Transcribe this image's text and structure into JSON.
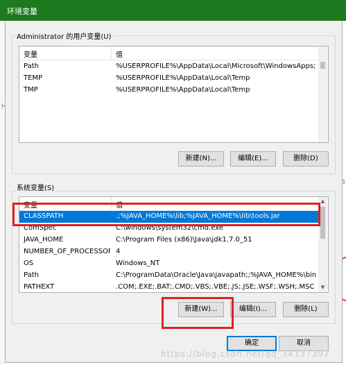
{
  "window": {
    "title": "环境变量"
  },
  "user_vars": {
    "group_label": "Administrator 的用户变量(U)",
    "col_var": "变量",
    "col_val": "值",
    "rows": [
      {
        "name": "Path",
        "value": "%USERPROFILE%\\AppData\\Local\\Microsoft\\WindowsApps;"
      },
      {
        "name": "TEMP",
        "value": "%USERPROFILE%\\AppData\\Local\\Temp"
      },
      {
        "name": "TMP",
        "value": "%USERPROFILE%\\AppData\\Local\\Temp"
      }
    ],
    "new_label": "新建(N)...",
    "edit_label": "编辑(E)...",
    "delete_label": "删除(D)"
  },
  "system_vars": {
    "group_label": "系统变量(S)",
    "col_var": "变量",
    "col_val": "值",
    "selected_index": 0,
    "rows": [
      {
        "name": "CLASSPATH",
        "value": ".;%JAVA_HOME%\\lib;%JAVA_HOME%\\lib\\tools.jar"
      },
      {
        "name": "ComSpec",
        "value": "C:\\windows\\system32\\cmd.exe"
      },
      {
        "name": "JAVA_HOME",
        "value": "C:\\Program Files (x86)\\Java\\jdk1.7.0_51"
      },
      {
        "name": "NUMBER_OF_PROCESSORS",
        "value": "4"
      },
      {
        "name": "OS",
        "value": "Windows_NT"
      },
      {
        "name": "Path",
        "value": "C:\\ProgramData\\Oracle\\Java\\javapath;;%JAVA_HOME%\\bin;..."
      },
      {
        "name": "PATHEXT",
        "value": ".COM;.EXE;.BAT;.CMD;.VBS;.VBE;.JS;.JSE;.WSF;.WSH;.MSC"
      }
    ],
    "new_label": "新建(W)...",
    "edit_label": "编辑(I)...",
    "delete_label": "删除(L)"
  },
  "footer": {
    "ok_label": "确定",
    "cancel_label": "取消"
  },
  "watermark": "https://blog.csdn.net/qq_34137397",
  "background_fragments": {
    "left_char": "ト",
    "right_number": "3"
  },
  "colors": {
    "titlebar": "#1e7a1e",
    "selection": "#0078d7",
    "highlight_box": "#e02020"
  },
  "icons": {
    "scroll_up": "triangle-up",
    "scroll_down": "triangle-down"
  }
}
